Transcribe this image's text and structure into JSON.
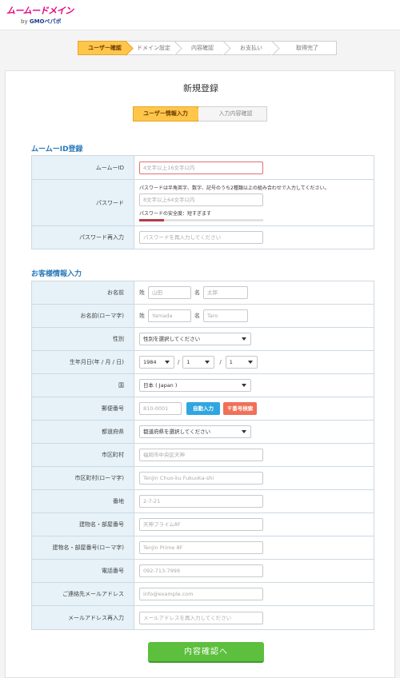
{
  "logo": {
    "main": "ムームードメイン",
    "sub_prefix": "by",
    "sub_brand": "GMOペパボ"
  },
  "steps": [
    {
      "label": "ユーザー確認",
      "active": true
    },
    {
      "label": "ドメイン設定",
      "active": false
    },
    {
      "label": "内容確認",
      "active": false
    },
    {
      "label": "お支払い",
      "active": false
    },
    {
      "label": "取得完了",
      "active": false
    }
  ],
  "page_title": "新規登録",
  "substeps": {
    "current": "ユーザー情報入力",
    "next": "入力内容確認"
  },
  "section1": {
    "title": "ムームーID登録",
    "id_label": "ムームーID",
    "id_placeholder": "4文字以上16文字以内",
    "pw_label": "パスワード",
    "pw_note": "パスワードは半角英字、数字、記号のうち2種類以上の組み合わせで入力してください。",
    "pw_placeholder": "8文字以上64文字以内",
    "pw_strength": "パスワードの安全度：短すぎます",
    "pw_strength_level": 0.2,
    "pw2_label": "パスワード再入力",
    "pw2_placeholder": "パスワードを再入力してください"
  },
  "section2": {
    "title": "お客様情報入力",
    "name_label": "お名前",
    "sei": "姓",
    "mei": "名",
    "sei_ph": "山田",
    "mei_ph": "太郎",
    "roma_label": "お名前(ローマ字)",
    "sei_roma_ph": "Yamada",
    "mei_roma_ph": "Taro",
    "gender_label": "性別",
    "gender_value": "性別を選択してください",
    "birth_label": "生年月日(年 / 月 / 日)",
    "birth_year": "1984",
    "birth_month": "1",
    "birth_day": "1",
    "sep": "/",
    "country_label": "国",
    "country_value": "日本 ( Japan )",
    "zip_label": "郵便番号",
    "zip_ph": "810-0001",
    "auto_btn": "自動入力",
    "zip_btn": "〒番号検索",
    "pref_label": "都道府県",
    "pref_value": "都道府県を選択してください",
    "city_label": "市区町村",
    "city_ph": "福岡市中央区天神",
    "city_roma_label": "市区町村(ローマ字)",
    "city_roma_ph": "Tenjin Chuo-ku Fukuoka-shi",
    "addr_label": "番地",
    "addr_ph": "2-7-21",
    "bldg_label": "建物名・部屋番号",
    "bldg_ph": "天神プライム8F",
    "bldg_roma_label": "建物名・部屋番号(ローマ字)",
    "bldg_roma_ph": "Tenjin Prime 8F",
    "tel_label": "電話番号",
    "tel_ph": "092-713-7999",
    "mail_label": "ご連絡先メールアドレス",
    "mail_ph": "info@example.com",
    "mail2_label": "メールアドレス再入力",
    "mail2_ph": "メールアドレスを再入力してください"
  },
  "submit": "内容確認へ",
  "colors": {
    "accent": "#ffc64a",
    "section": "#2a79b8",
    "submit": "#5cbf3d",
    "error": "#e07070"
  }
}
